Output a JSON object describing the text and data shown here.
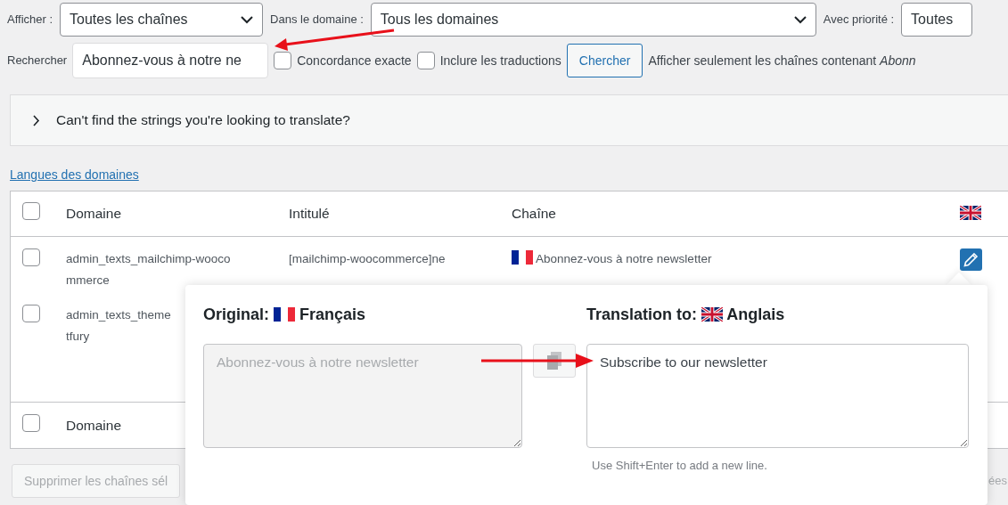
{
  "filters": [
    {
      "label": "Afficher :",
      "value": "Toutes les chaînes"
    },
    {
      "label": "Dans le domaine :",
      "value": "Tous les domaines"
    },
    {
      "label": "Avec priorité :",
      "value": "Toutes"
    }
  ],
  "search": {
    "label": "Rechercher",
    "value": "Abonnez-vous à notre ne",
    "options": [
      {
        "label": "Concordance exacte",
        "checked": false
      },
      {
        "label": "Inclure les traductions",
        "checked": false
      }
    ],
    "button": "Chercher",
    "summary": "Afficher seulement les chaînes contenant *Abonn*"
  },
  "help_panel": {
    "text": "Can't find the strings you're looking to translate?",
    "expanded": false
  },
  "domain_languages_link": "Langues des domaines",
  "table": {
    "columns": [
      "Domaine",
      "Intitulé",
      "Chaîne"
    ],
    "header_checked": false,
    "rows": [
      {
        "checked": false,
        "domain_lines": [
          "admin_texts_mailchimp-wooco",
          "mmerce"
        ],
        "name": "[mailchimp-woocommerce]ne",
        "string": "Abonnez-vous à notre newsletter"
      },
      {
        "checked": false,
        "domain_lines": [
          "admin_texts_theme",
          "tfury"
        ]
      }
    ],
    "footer_column": "Domaine",
    "footer_checked": false
  },
  "bulk_button": "Supprimer les chaînes sél",
  "right_edge_text": "ées",
  "editor": {
    "original_label": "Original:",
    "original_language": "Français",
    "original_text": "Abonnez-vous à notre newsletter",
    "target_label": "Translation to:",
    "target_language": "Anglais",
    "translation": "Subscribe to our newsletter",
    "hint": "Use Shift+Enter to add a new line."
  }
}
